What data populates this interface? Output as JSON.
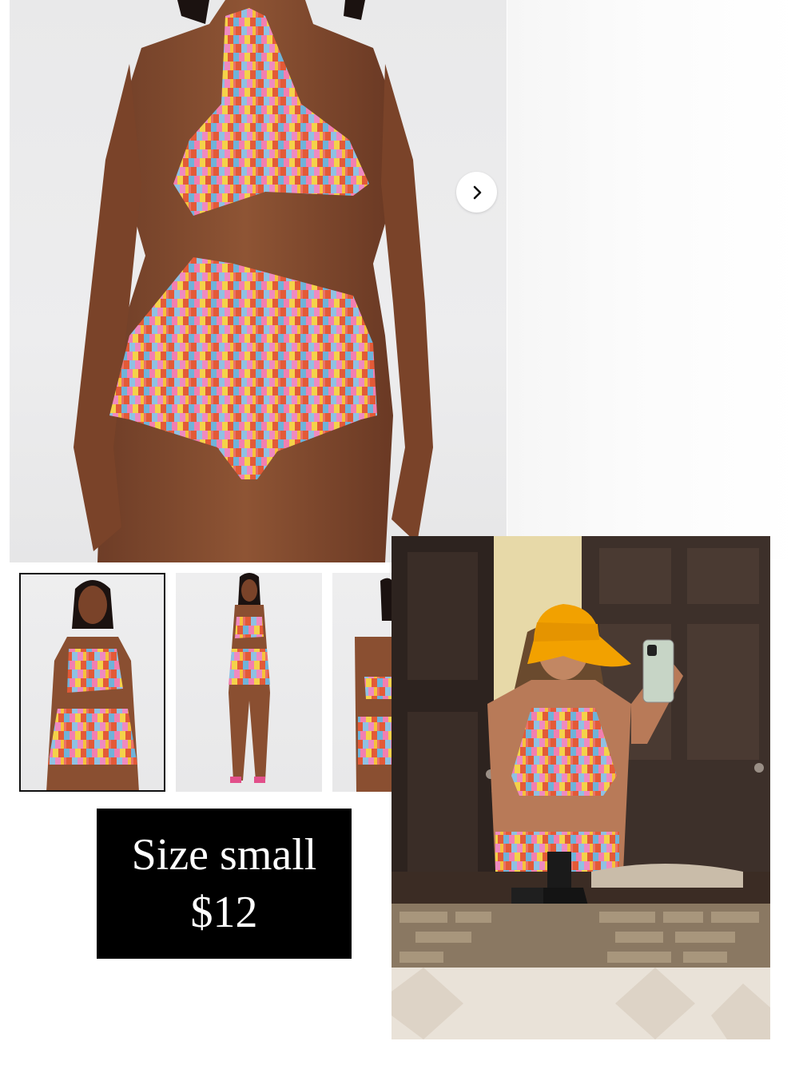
{
  "product": {
    "main_image": "product-photo-model-crochet-set",
    "thumbnails": [
      {
        "image": "thumbnail-front-closeup",
        "selected": true
      },
      {
        "image": "thumbnail-full-body",
        "selected": false
      },
      {
        "image": "thumbnail-back-view",
        "selected": false
      }
    ],
    "next_icon": "chevron-right-icon"
  },
  "overlay": {
    "size_label": "Size small",
    "price": "$12"
  },
  "mirror_photo": {
    "image": "mirror-selfie-wearing-set"
  },
  "colors": {
    "price_box_bg": "#000000",
    "price_box_text": "#ffffff",
    "hat": "#f2a100"
  }
}
